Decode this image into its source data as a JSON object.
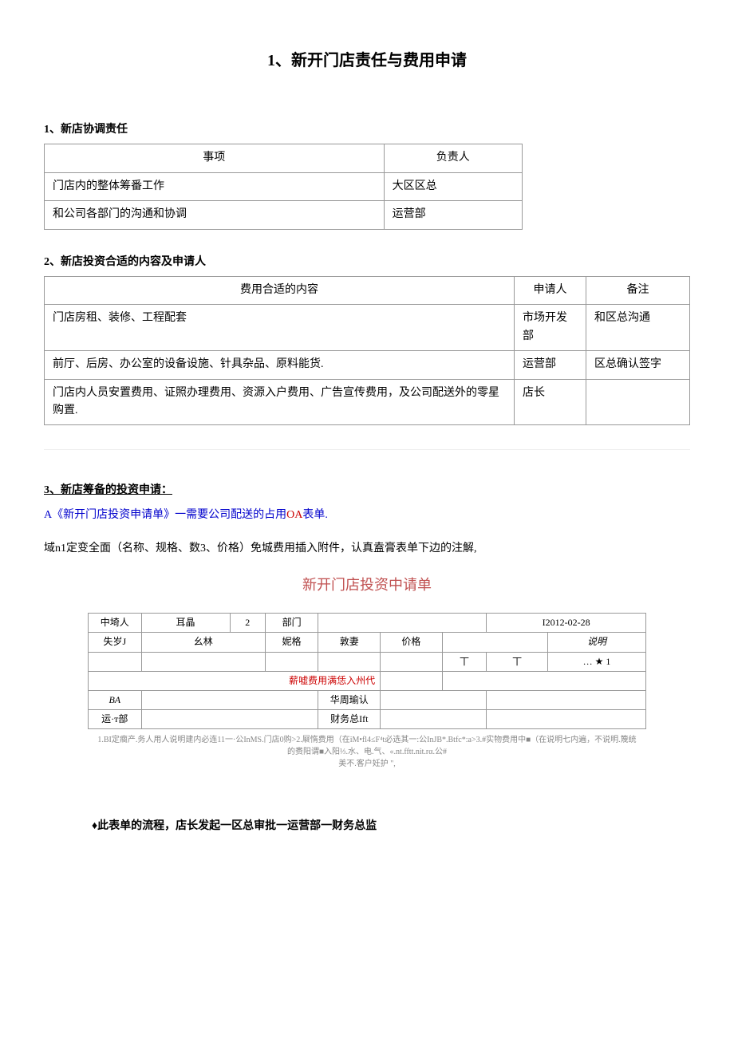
{
  "title": "1、新开门店责任与费用申请",
  "section1": {
    "heading": "1、新店协调责任",
    "headers": [
      "事项",
      "负责人"
    ],
    "rows": [
      [
        "门店内的整体筹番工作",
        "大区区总"
      ],
      [
        "和公司各部门的沟通和协调",
        "运营部"
      ]
    ]
  },
  "section2": {
    "heading": "2、新店投资合适的内容及申请人",
    "headers": [
      "费用合适的内容",
      "申请人",
      "备注"
    ],
    "rows": [
      [
        "门店房租、装修、工程配套",
        "市场开发部",
        "和区总沟通"
      ],
      [
        "前厅、后房、办公室的设备设施、针具杂品、原料能货.",
        "运营部",
        "区总确认签字"
      ],
      [
        "门店内人员安置费用、证照办理费用、资源入户费用、广告宣传费用，及公司配送外的零星购置.",
        "店长",
        ""
      ]
    ]
  },
  "section3": {
    "heading": "3、新店筹备的投资申请：",
    "line_a_pre": "A《新开门店投资申请单》一需要公司配送的占用",
    "line_a_red": "OA",
    "line_a_post": "表单.",
    "note": "域n1定变全面（名称、规格、数3、价格）免城费用插入附件，认真盍膏表单下边的注解,",
    "form_title": "新开门店投资中请单",
    "form": {
      "r1": [
        "中埼人",
        "耳晶",
        "2",
        "部门",
        "",
        "I2012-02-28"
      ],
      "r2": [
        "失岁J",
        "幺林",
        "妮格",
        "敦妻",
        "价格",
        "",
        "说明"
      ],
      "r3": [
        "",
        "",
        "",
        "",
        "",
        "丅",
        "丅",
        "… ★ 1"
      ],
      "r4_label": "薪嘘费用满恁入州代",
      "r5": [
        "BA",
        "",
        "华周瑜认",
        "",
        ""
      ],
      "r6": [
        "运·т部",
        "",
        "财务总Ift",
        "",
        ""
      ]
    },
    "footnote": {
      "p1": "1.BI定癎产.务人用人说明建内必连11一·公InMS.门店0购>2.㞡惰费用（在iM•fl4≤F⁴t必选其一:公InJB*.Btfc*:a>3.#实物费用中■（在说明七内遍，不说明.篾统",
      "p2": "的赉阳谓■入阳⅓.水、电.气、«.nt.fftt.nit.rα.公#",
      "p3": "美不.客户妊护 \","
    },
    "process": "♦此表单的流程，店长发起一区总审批一运营部一财务总监"
  }
}
